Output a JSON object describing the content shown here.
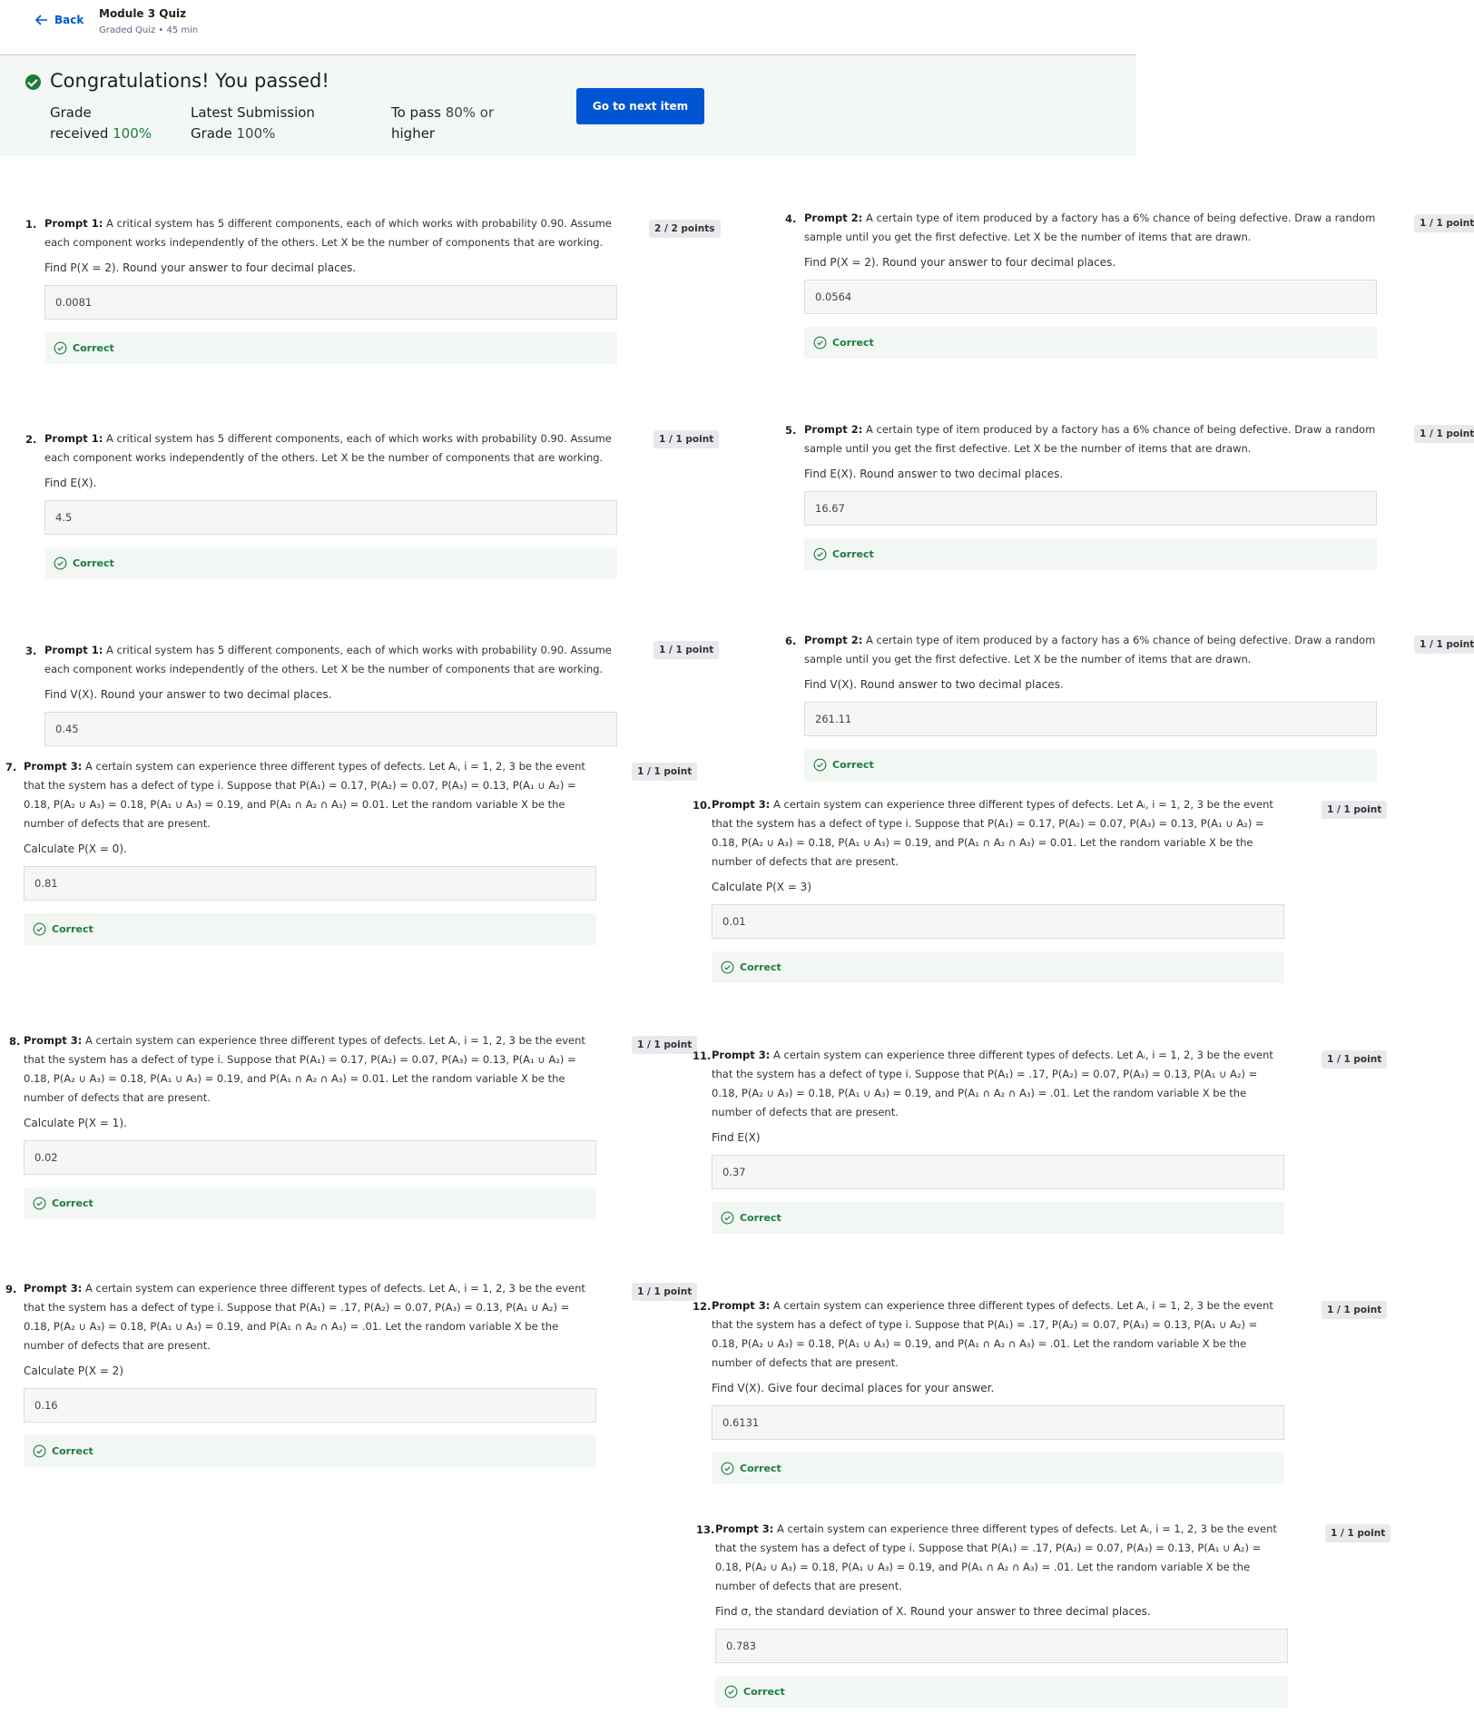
{
  "header": {
    "back_label": "Back",
    "title": "Module 3 Quiz",
    "subtitle": "Graded Quiz • 45 min"
  },
  "result": {
    "title": "Congratulations! You passed!",
    "grade_label_1": "Grade",
    "grade_label_2": "received",
    "grade_value": "100%",
    "latest_label_1": "Latest Submission",
    "latest_label_2": "Grade",
    "latest_value": "100%",
    "pass_label_1": "To pass",
    "pass_value": "80% or",
    "pass_label_2": "higher",
    "next_button": "Go to next item"
  },
  "questions": [
    {
      "num": "1.",
      "prompt": "Prompt 1:",
      "text": "A critical system has 5 different components, each of which works with probability 0.90. Assume each component works independently of the others. Let X be the number of components that are working.",
      "ask": "Find P(X = 2). Round your answer to four decimal places.",
      "answer": "0.0081",
      "status": "Correct",
      "points": "2 / 2 points"
    },
    {
      "num": "2.",
      "prompt": "Prompt 1:",
      "text": "A critical system has 5 different components, each of which works with probability 0.90. Assume each component works independently of the others. Let X be the number of components that are working.",
      "ask": "Find E(X).",
      "answer": "4.5",
      "status": "Correct",
      "points": "1 / 1 point"
    },
    {
      "num": "3.",
      "prompt": "Prompt 1:",
      "text": "A critical system has 5 different components, each of which works with probability 0.90. Assume each component works independently of the others. Let X be the number of components that are working.",
      "ask": "Find V(X). Round your answer to two decimal places.",
      "answer": "0.45",
      "status": "",
      "points": "1 / 1 point"
    },
    {
      "num": "4.",
      "prompt": "Prompt 2:",
      "text": "A certain type of item produced by a factory has a 6% chance of being defective. Draw a random sample until you get the first defective. Let X be the number of items that are drawn.",
      "ask": "Find P(X = 2). Round your answer to four decimal places.",
      "answer": "0.0564",
      "status": "Correct",
      "points": "1 / 1 point"
    },
    {
      "num": "5.",
      "prompt": "Prompt 2:",
      "text": "A certain type of item produced by a factory has a 6% chance of being defective. Draw a random sample until you get the first defective. Let X be the number of items that are drawn.",
      "ask": "Find E(X). Round answer to two decimal places.",
      "answer": "16.67",
      "status": "Correct",
      "points": "1 / 1 point"
    },
    {
      "num": "6.",
      "prompt": "Prompt 2:",
      "text": "A certain type of item produced by a factory has a 6% chance of being defective. Draw a random sample until you get the first defective. Let X be the number of items that are drawn.",
      "ask": "Find V(X). Round answer to two decimal places.",
      "answer": "261.11",
      "status": "Correct",
      "points": "1 / 1 point"
    },
    {
      "num": "7.",
      "prompt": "Prompt 3:",
      "text": "A certain system can experience three different types of defects. Let Aᵢ, i = 1, 2, 3 be the event that the system has a defect of type i. Suppose that P(A₁) = 0.17, P(A₂) = 0.07, P(A₃) = 0.13, P(A₁ ∪ A₂) = 0.18, P(A₂ ∪ A₃) = 0.18, P(A₁ ∪ A₃) = 0.19, and P(A₁ ∩ A₂ ∩ A₃) = 0.01. Let the random variable X be the number of defects that are present.",
      "ask": "Calculate P(X = 0).",
      "answer": "0.81",
      "status": "Correct",
      "points": "1 / 1 point"
    },
    {
      "num": "8.",
      "prompt": "Prompt 3:",
      "text": "A certain system can experience three different types of defects. Let Aᵢ, i = 1, 2, 3 be the event that the system has a defect of type i. Suppose that P(A₁) = 0.17, P(A₂) = 0.07, P(A₃) = 0.13, P(A₁ ∪ A₂) = 0.18, P(A₂ ∪ A₃) = 0.18, P(A₁ ∪ A₃) = 0.19, and P(A₁ ∩ A₂ ∩ A₃) = 0.01. Let the random variable X be the number of defects that are present.",
      "ask": "Calculate P(X = 1).",
      "answer": "0.02",
      "status": "Correct",
      "points": "1 / 1 point"
    },
    {
      "num": "9.",
      "prompt": "Prompt 3:",
      "text": "A certain system can experience three different types of defects. Let Aᵢ, i = 1, 2, 3 be the event that the system has a defect of type i. Suppose that P(A₁) = .17, P(A₂) = 0.07, P(A₃) = 0.13, P(A₁ ∪ A₂) = 0.18, P(A₂ ∪ A₃) = 0.18, P(A₁ ∪ A₃) = 0.19, and P(A₁ ∩ A₂ ∩ A₃) = .01. Let the random variable X be the number of defects that are present.",
      "ask": "Calculate P(X = 2)",
      "answer": "0.16",
      "status": "Correct",
      "points": "1 / 1 point"
    },
    {
      "num": "10.",
      "prompt": "Prompt 3:",
      "text": "A certain system can experience three different types of defects. Let Aᵢ, i = 1, 2, 3 be the event that the system has a defect of type i. Suppose that P(A₁) = 0.17, P(A₂) = 0.07, P(A₃) = 0.13, P(A₁ ∪ A₂) = 0.18, P(A₂ ∪ A₃) = 0.18, P(A₁ ∪ A₃) = 0.19, and P(A₁ ∩ A₂ ∩ A₃) = 0.01. Let the random variable X be the number of defects that are present.",
      "ask": "Calculate P(X = 3)",
      "answer": "0.01",
      "status": "Correct",
      "points": "1 / 1 point"
    },
    {
      "num": "11.",
      "prompt": "Prompt 3:",
      "text": "A certain system can experience three different types of defects. Let Aᵢ, i = 1, 2, 3 be the event that the system has a defect of type i. Suppose that P(A₁) = .17, P(A₂) = 0.07, P(A₃) = 0.13, P(A₁ ∪ A₂) = 0.18, P(A₂ ∪ A₃) = 0.18, P(A₁ ∪ A₃) = 0.19, and P(A₁ ∩ A₂ ∩ A₃) = .01. Let the random variable X be the number of defects that are present.",
      "ask": "Find E(X)",
      "answer": "0.37",
      "status": "Correct",
      "points": "1 / 1 point"
    },
    {
      "num": "12.",
      "prompt": "Prompt 3:",
      "text": "A certain system can experience three different types of defects. Let Aᵢ, i = 1, 2, 3 be the event that the system has a defect of type i. Suppose that P(A₁) = .17, P(A₂) = 0.07, P(A₃) = 0.13, P(A₁ ∪ A₂) = 0.18, P(A₂ ∪ A₃) = 0.18, P(A₁ ∪ A₃) = 0.19, and P(A₁ ∩ A₂ ∩ A₃) = .01. Let the random variable X be the number of defects that are present.",
      "ask": "Find V(X). Give four decimal places for your answer.",
      "answer": "0.6131",
      "status": "Correct",
      "points": "1 / 1 point"
    },
    {
      "num": "13.",
      "prompt": "Prompt 3:",
      "text": "A certain system can experience three different types of defects. Let Aᵢ, i = 1, 2, 3 be the event that the system has a defect of type i. Suppose that P(A₁) = .17, P(A₂) = 0.07, P(A₃) = 0.13, P(A₁ ∪ A₂) = 0.18, P(A₂ ∪ A₃) = 0.18, P(A₁ ∪ A₃) = 0.19, and P(A₁ ∩ A₂ ∩ A₃) = .01. Let the random variable X be the number of defects that are present.",
      "ask": "Find σ, the standard deviation of X. Round your answer to three decimal places.",
      "answer": "0.783",
      "status": "Correct",
      "points": "1 / 1 point"
    }
  ],
  "icons": {
    "back": "arrow-left-icon",
    "pass": "check-circle-icon",
    "correct": "check-circle-outline-icon"
  },
  "colors": {
    "primary": "#0056d2",
    "success": "#1e7b3e",
    "banner_bg": "#f3f7f6"
  }
}
